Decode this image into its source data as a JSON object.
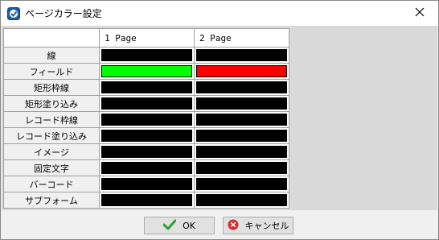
{
  "window": {
    "title": "ページカラー設定"
  },
  "grid": {
    "columns": [
      "1 Page",
      "2 Page"
    ],
    "rows": [
      {
        "label": "線",
        "colors": [
          "#000000",
          "#000000"
        ]
      },
      {
        "label": "フィールド",
        "colors": [
          "#00ff00",
          "#ff0000"
        ]
      },
      {
        "label": "矩形枠線",
        "colors": [
          "#000000",
          "#000000"
        ]
      },
      {
        "label": "矩形塗り込み",
        "colors": [
          "#000000",
          "#000000"
        ]
      },
      {
        "label": "レコード枠線",
        "colors": [
          "#000000",
          "#000000"
        ]
      },
      {
        "label": "レコード塗り込み",
        "colors": [
          "#000000",
          "#000000"
        ]
      },
      {
        "label": "イメージ",
        "colors": [
          "#000000",
          "#000000"
        ]
      },
      {
        "label": "固定文字",
        "colors": [
          "#000000",
          "#000000"
        ]
      },
      {
        "label": "バーコード",
        "colors": [
          "#000000",
          "#000000"
        ]
      },
      {
        "label": "サブフォーム",
        "colors": [
          "#000000",
          "#000000"
        ]
      }
    ]
  },
  "buttons": {
    "ok_label": "OK",
    "cancel_label": "キャンセル"
  },
  "icons": {
    "app": "app-icon",
    "close": "close-icon",
    "ok": "check-icon",
    "cancel": "cancel-icon"
  }
}
